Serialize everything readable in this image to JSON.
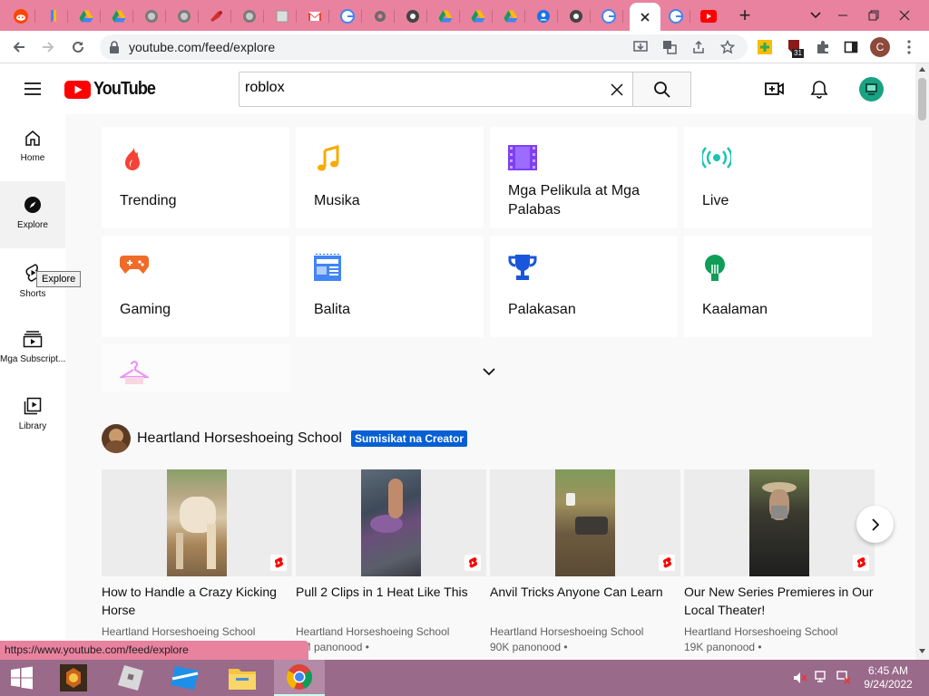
{
  "browser": {
    "tabs": [
      {
        "icon": "reddit-icon"
      },
      {
        "icon": "bookmark-icon"
      },
      {
        "icon": "google-drive-icon"
      },
      {
        "icon": "google-drive-icon"
      },
      {
        "icon": "globe-icon"
      },
      {
        "icon": "globe-icon"
      },
      {
        "icon": "game-icon"
      },
      {
        "icon": "globe-icon"
      },
      {
        "icon": "page-icon"
      },
      {
        "icon": "gmail-icon"
      },
      {
        "icon": "google-icon"
      },
      {
        "icon": "settings-icon"
      },
      {
        "icon": "chrome-icon"
      },
      {
        "icon": "google-drive-icon"
      },
      {
        "icon": "google-drive-icon"
      },
      {
        "icon": "google-drive-icon"
      },
      {
        "icon": "account-icon"
      },
      {
        "icon": "chrome-icon"
      },
      {
        "icon": "google-icon"
      },
      {
        "icon": "close-icon"
      },
      {
        "icon": "google-icon"
      },
      {
        "icon": "youtube-icon"
      }
    ],
    "new_tab_symbol": "+",
    "url": "youtube.com/feed/explore",
    "profile_initial": "C",
    "extension_badge": "31",
    "status_url": "https://www.youtube.com/feed/explore"
  },
  "youtube": {
    "logo_text": "YouTube",
    "search_value": "roblox",
    "rail": [
      {
        "label": "Home",
        "icon": "home-icon"
      },
      {
        "label": "Explore",
        "icon": "compass-icon"
      },
      {
        "label": "Shorts",
        "icon": "shorts-icon"
      },
      {
        "label": "Mga Subscript...",
        "icon": "subscriptions-icon"
      },
      {
        "label": "Library",
        "icon": "library-icon"
      }
    ],
    "tooltip": "Explore",
    "categories": [
      {
        "label": "Trending",
        "icon": "flame-icon"
      },
      {
        "label": "Musika",
        "icon": "music-note-icon"
      },
      {
        "label": "Mga Pelikula at Mga Palabas",
        "icon": "film-icon"
      },
      {
        "label": "Live",
        "icon": "live-icon"
      },
      {
        "label": "Gaming",
        "icon": "gamepad-icon"
      },
      {
        "label": "Balita",
        "icon": "news-icon"
      },
      {
        "label": "Palakasan",
        "icon": "trophy-icon"
      },
      {
        "label": "Kaalaman",
        "icon": "lightbulb-icon"
      }
    ],
    "extra_category_icon": "hanger-icon",
    "channel": {
      "name": "Heartland Horseshoeing School",
      "badge": "Sumisikat na Creator"
    },
    "videos": [
      {
        "title": "How to Handle a Crazy Kicking Horse",
        "channel": "Heartland Horseshoeing School",
        "views": ""
      },
      {
        "title": "Pull 2 Clips in 1 Heat Like This",
        "channel": "Heartland Horseshoeing School",
        "views": "6M panonood"
      },
      {
        "title": "Anvil Tricks Anyone Can Learn",
        "channel": "Heartland Horseshoeing School",
        "views": "90K panonood"
      },
      {
        "title": "Our New Series Premieres in Our Local Theater!",
        "channel": "Heartland Horseshoeing School",
        "views": "19K panonood"
      }
    ],
    "colors": {
      "red": "#ff0000",
      "badge_blue": "#065fd4"
    }
  },
  "taskbar": {
    "apps": [
      "windows-start-icon",
      "game-app-icon",
      "roblox-icon",
      "roblox-studio-icon",
      "file-explorer-icon",
      "chrome-icon"
    ],
    "time": "6:45 AM",
    "date": "9/24/2022"
  }
}
